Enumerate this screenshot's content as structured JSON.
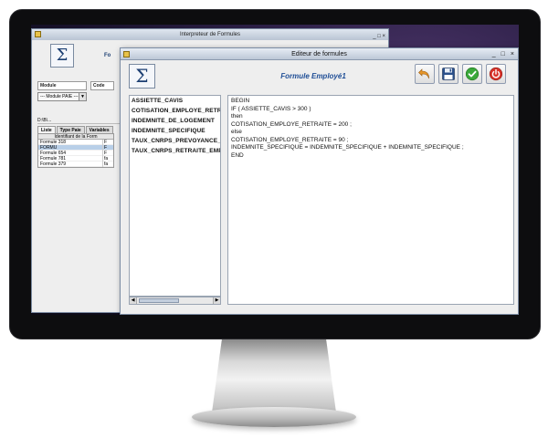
{
  "background_window": {
    "title": "Interpreteur de Formules",
    "window_controls": "_ □ ×",
    "sigma": "Σ",
    "tab_peek": "Fo",
    "labels": {
      "module": "Module",
      "code": "Code"
    },
    "module_select": "--- Module PAIE ---",
    "path_field": "D:\\B\\...",
    "tabs": [
      "Liste",
      "Type Paie",
      "Variables"
    ],
    "table_header": "Identifiant de la Form",
    "rows": [
      "Formule 318",
      "FORMU",
      "Formule 654",
      "Formule 781",
      "Formule 379"
    ],
    "row_cuts": [
      "F",
      "F",
      "F",
      "fa",
      "fa"
    ]
  },
  "editor": {
    "title": "Editeur de formules",
    "window_controls": [
      "_",
      "□",
      "×"
    ],
    "sigma": "Σ",
    "formula_title": "Formule Employé1",
    "toolbar": {
      "undo_icon": "undo-arrow",
      "save_icon": "floppy-disk",
      "validate_icon": "check-circle",
      "close_icon": "power-off"
    },
    "variables": [
      "ASSIETTE_CAVIS",
      "COTISATION_EMPLOYE_RETRA",
      "INDEMNITE_DE_LOGEMENT",
      "INDEMNITE_SPECIFIQUE",
      "TAUX_CNRPS_PREVOYANCE_S",
      "TAUX_CNRPS_RETRAITE_EMPL"
    ],
    "scrollbar": {
      "left_arrow": "◀",
      "right_arrow": "▶"
    },
    "code_lines": [
      "BEGIN",
      "IF ( ASSIETTE_CAVIS > 300 )",
      "then",
      "COTISATION_EMPLOYE_RETRAITE = 200 ;",
      "else",
      "COTISATION_EMPLOYE_RETRAITE = 90 ;",
      "INDEMNITE_SPECIFIQUE = INDEMNITE_SPECIFIQUE + INDEMNITE_SPECIFIQUE ;",
      "END"
    ]
  },
  "colors": {
    "accent": "#1f4e96",
    "undo": "#e6962a",
    "save": "#2a4f8a",
    "validate": "#3aa83a",
    "close": "#d8332a"
  }
}
